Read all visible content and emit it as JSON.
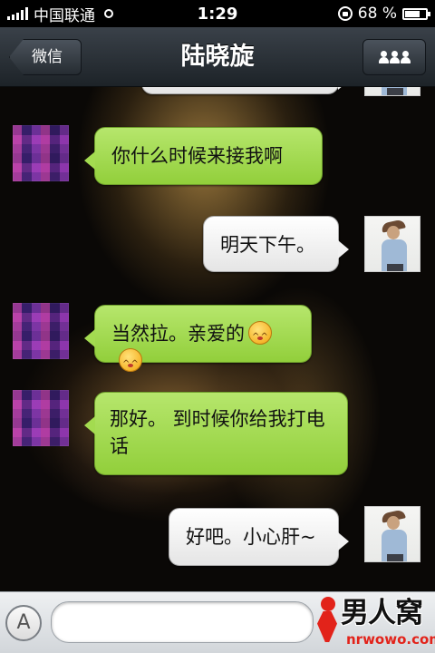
{
  "status_bar": {
    "carrier": "中国联通",
    "time": "1:29",
    "battery": "68 %"
  },
  "nav": {
    "back_label": "微信",
    "title": "陆晓旋"
  },
  "messages": [
    {
      "side": "out",
      "text": ""
    },
    {
      "side": "in",
      "text": "你什么时候来接我啊"
    },
    {
      "side": "out",
      "text": "明天下午。"
    },
    {
      "side": "in",
      "text": "当然拉。亲爱的",
      "emoji_count": 2
    },
    {
      "side": "in",
      "text": "那好。 到时候你给我打电话"
    },
    {
      "side": "out",
      "text": "好吧。小心肝~"
    }
  ],
  "input": {
    "placeholder": "",
    "value": ""
  },
  "watermark": {
    "brand": "男人窝",
    "url": "nrwowo.com"
  },
  "colors": {
    "incoming_bubble": "#a3db50",
    "outgoing_bubble": "#f1f1f1",
    "nav_bar": "#2a3037"
  }
}
